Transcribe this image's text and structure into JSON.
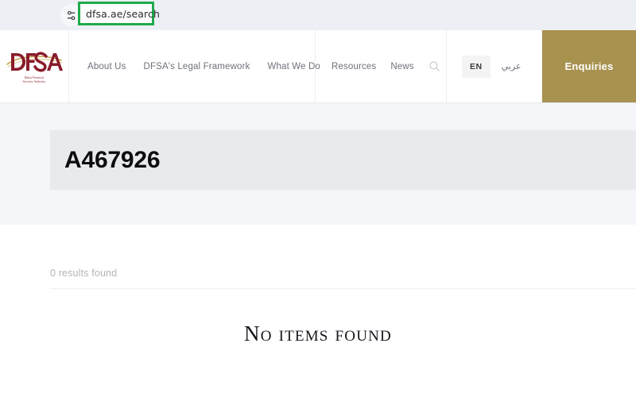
{
  "browser": {
    "url": "dfsa.ae/search",
    "settings_icon": "sliders-icon",
    "highlight_color": "#1faa4b"
  },
  "header": {
    "logo": {
      "mark": "DFSA",
      "subtitle_line1": "Dubai Financial",
      "subtitle_line2": "Services Authority",
      "brand_color": "#8a1c2b",
      "accent_color": "#c8a24a"
    },
    "primary_nav": [
      {
        "label": "About Us"
      },
      {
        "label": "DFSA's Legal Framework"
      },
      {
        "label": "What We Do"
      }
    ],
    "secondary_nav": [
      {
        "label": "Resources"
      },
      {
        "label": "News"
      }
    ],
    "search_icon": "search-icon",
    "language": {
      "active": "EN",
      "alternate": "عربي"
    },
    "cta": {
      "label": "Enquiries",
      "color": "#a8924f"
    }
  },
  "hero": {
    "query": "A467926"
  },
  "results": {
    "count_label": "0 results found",
    "empty_message": "No items found"
  }
}
